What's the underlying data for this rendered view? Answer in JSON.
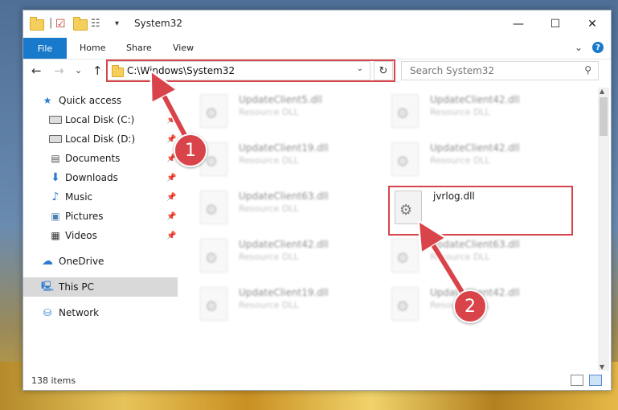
{
  "window": {
    "title": "System32",
    "minimize": "—",
    "maximize": "☐",
    "close": "✕"
  },
  "ribbon": {
    "tabs": [
      "File",
      "Home",
      "Share",
      "View"
    ],
    "expand": "⌄",
    "help": "?"
  },
  "nav": {
    "back": "←",
    "forward": "→",
    "recent": "⌄",
    "up": "↑",
    "address": "C:\\Windows\\System32",
    "refresh": "↻",
    "search_placeholder": "Search System32"
  },
  "sidebar": {
    "items": [
      {
        "label": "Quick access",
        "icon": "star-icon",
        "pinned": false
      },
      {
        "label": "Local Disk (C:)",
        "icon": "drive-icon",
        "pinned": true
      },
      {
        "label": "Local Disk (D:)",
        "icon": "drive-icon",
        "pinned": true
      },
      {
        "label": "Documents",
        "icon": "documents-icon",
        "pinned": true
      },
      {
        "label": "Downloads",
        "icon": "download-icon",
        "pinned": true
      },
      {
        "label": "Music",
        "icon": "music-icon",
        "pinned": true
      },
      {
        "label": "Pictures",
        "icon": "pictures-icon",
        "pinned": true
      },
      {
        "label": "Videos",
        "icon": "videos-icon",
        "pinned": true
      },
      {
        "label": "OneDrive",
        "icon": "cloud-icon",
        "pinned": false
      },
      {
        "label": "This PC",
        "icon": "computer-icon",
        "pinned": false,
        "selected": true
      },
      {
        "label": "Network",
        "icon": "network-icon",
        "pinned": false
      }
    ]
  },
  "files": [
    {
      "name": "UpdateClient5.dll",
      "desc": "Resource DLL",
      "blurred": true
    },
    {
      "name": "UpdateClient42.dll",
      "desc": "Resource DLL",
      "blurred": true
    },
    {
      "name": "UpdateClient19.dll",
      "desc": "Resource DLL",
      "blurred": true
    },
    {
      "name": "UpdateClient42.dll",
      "desc": "Resource DLL",
      "blurred": true
    },
    {
      "name": "UpdateClient63.dll",
      "desc": "Resource DLL",
      "blurred": true
    },
    {
      "name": "jvrlog.dll",
      "desc": "",
      "blurred": false
    },
    {
      "name": "UpdateClient42.dll",
      "desc": "Resource DLL",
      "blurred": true
    },
    {
      "name": "UpdateClient63.dll",
      "desc": "Resource DLL",
      "blurred": true
    },
    {
      "name": "UpdateClient19.dll",
      "desc": "Resource DLL",
      "blurred": true
    },
    {
      "name": "UpdateClient42.dll",
      "desc": "Resource DLL",
      "blurred": true
    }
  ],
  "status": {
    "count": "138 items"
  },
  "callouts": [
    "1",
    "2"
  ],
  "colors": {
    "accent": "#1979ca",
    "highlight": "#d9444b"
  }
}
